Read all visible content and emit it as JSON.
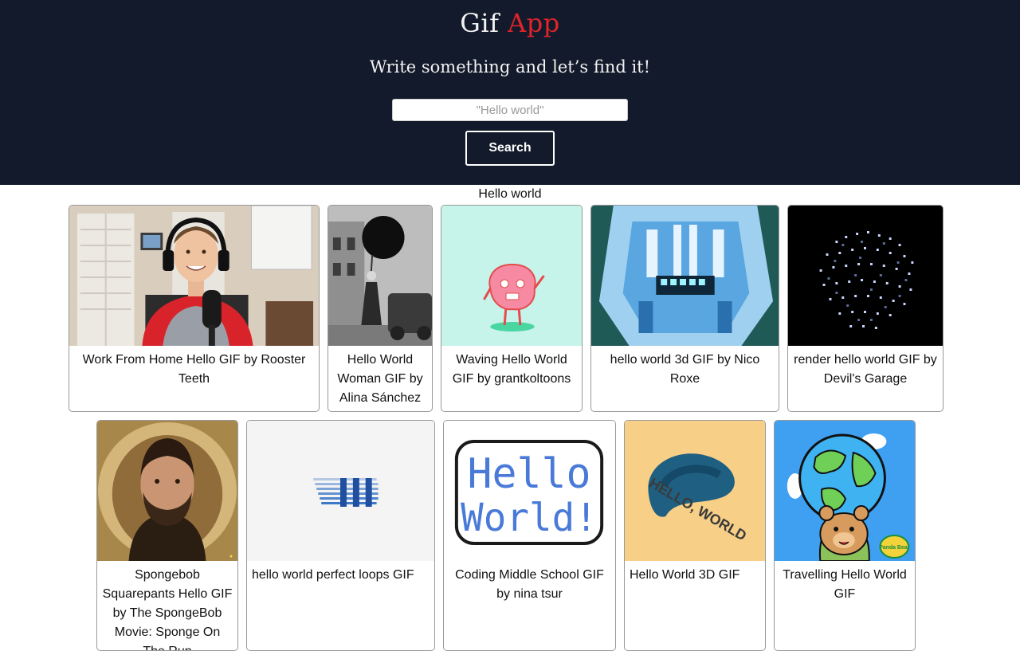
{
  "app": {
    "title_part1": "Gif",
    "title_part2": "App"
  },
  "hero": {
    "tagline": "Write something and let’s find it!",
    "search_placeholder": "\"Hello world\"",
    "search_value": "",
    "search_button": "Search"
  },
  "results": {
    "query": "Hello world",
    "gifs": [
      {
        "title": "Work From Home Hello GIF by Rooster Teeth",
        "image": "man-with-headset-and-microphone"
      },
      {
        "title": "Hello World Woman GIF by Alina Sánchez",
        "image": "woman-holding-black-balloon"
      },
      {
        "title": "Waving Hello World GIF by grantkoltoons",
        "image": "pink-cartoon-waving"
      },
      {
        "title": "hello world 3d GIF by Nico Roxe",
        "image": "blue-3d-face"
      },
      {
        "title": "render hello world GIF by Devil's Garage",
        "image": "particle-sphere"
      },
      {
        "title": "Spongebob Squarepants Hello GIF by The SpongeBob Movie: Sponge On The Run",
        "image": "bearded-man-in-nest"
      },
      {
        "title": "hello world perfect loops GIF",
        "image": "blue-striped-loop"
      },
      {
        "title": "Coding Middle School GIF by nina tsur",
        "image": "hello-world-sign"
      },
      {
        "title": "Hello World 3D GIF",
        "image": "blue-blob-hello-world"
      },
      {
        "title": "Travelling Hello World GIF",
        "image": "bear-holding-globe"
      }
    ],
    "overlays": {
      "sign_line1": "Hello",
      "sign_line2": "World!",
      "blob_text": "HELLO, WORLD",
      "watermark": "Panda Bear"
    }
  }
}
